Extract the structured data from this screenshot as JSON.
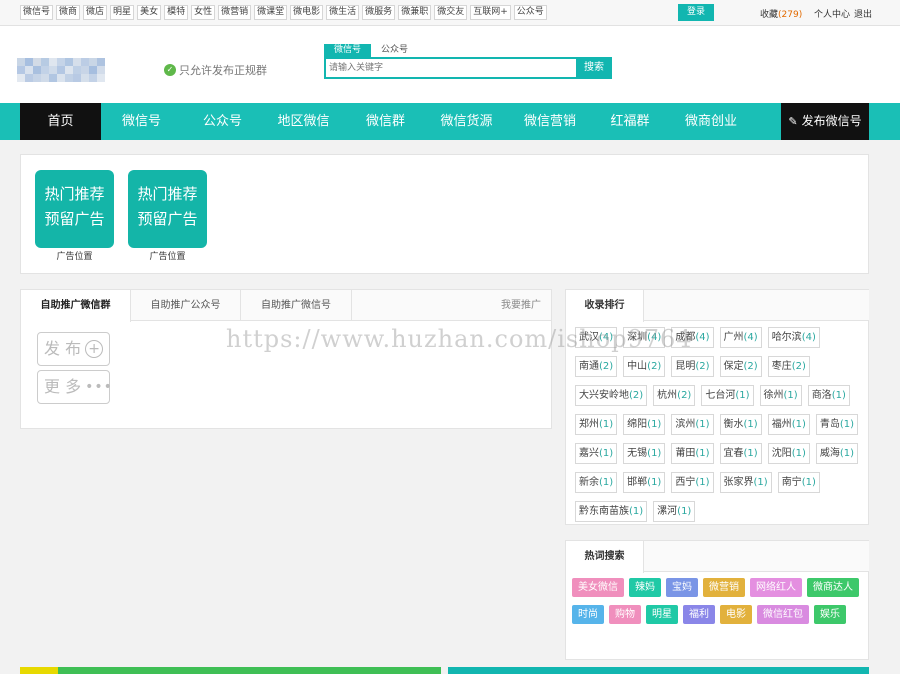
{
  "topbar": {
    "links": [
      "微信号",
      "微商",
      "微店",
      "明星",
      "美女",
      "模特",
      "女性",
      "微营销",
      "微课堂",
      "微电影",
      "微生活",
      "微服务",
      "微兼职",
      "微交友",
      "互联网+",
      "公众号"
    ],
    "login": "登录",
    "fav_label": "收藏",
    "fav_count": "(279)",
    "user_center": "个人中心",
    "logout": "退出"
  },
  "header": {
    "notice": "只允许发布正规群",
    "search_tabs": [
      "微信号",
      "公众号"
    ],
    "search_placeholder": "请输入关键字",
    "search_button": "搜索"
  },
  "nav": {
    "items": [
      "首页",
      "微信号",
      "公众号",
      "地区微信",
      "微信群",
      "微信货源",
      "微信营销",
      "红福群",
      "微商创业"
    ],
    "publish": "发布微信号"
  },
  "ads": [
    {
      "line1": "热门推荐",
      "line2": "预留广告",
      "caption": "广告位置"
    },
    {
      "line1": "热门推荐",
      "line2": "预留广告",
      "caption": "广告位置"
    }
  ],
  "promo": {
    "tabs": [
      "自助推广微信群",
      "自助推广公众号",
      "自助推广微信号"
    ],
    "my_promo": "我要推广",
    "publish": "发 布",
    "more": "更 多"
  },
  "ranking": {
    "title": "收录排行",
    "cities": [
      {
        "name": "武汉",
        "count": "(4)"
      },
      {
        "name": "深圳",
        "count": "(4)"
      },
      {
        "name": "成都",
        "count": "(4)"
      },
      {
        "name": "广州",
        "count": "(4)"
      },
      {
        "name": "哈尔滨",
        "count": "(4)"
      },
      {
        "name": "南通",
        "count": "(2)"
      },
      {
        "name": "中山",
        "count": "(2)"
      },
      {
        "name": "昆明",
        "count": "(2)"
      },
      {
        "name": "保定",
        "count": "(2)"
      },
      {
        "name": "枣庄",
        "count": "(2)"
      },
      {
        "name": "大兴安岭地",
        "count": "(2)"
      },
      {
        "name": "杭州",
        "count": "(2)"
      },
      {
        "name": "七台河",
        "count": "(1)"
      },
      {
        "name": "徐州",
        "count": "(1)"
      },
      {
        "name": "商洛",
        "count": "(1)"
      },
      {
        "name": "郑州",
        "count": "(1)"
      },
      {
        "name": "绵阳",
        "count": "(1)"
      },
      {
        "name": "滨州",
        "count": "(1)"
      },
      {
        "name": "衡水",
        "count": "(1)"
      },
      {
        "name": "福州",
        "count": "(1)"
      },
      {
        "name": "青岛",
        "count": "(1)"
      },
      {
        "name": "嘉兴",
        "count": "(1)"
      },
      {
        "name": "无锡",
        "count": "(1)"
      },
      {
        "name": "莆田",
        "count": "(1)"
      },
      {
        "name": "宜春",
        "count": "(1)"
      },
      {
        "name": "沈阳",
        "count": "(1)"
      },
      {
        "name": "威海",
        "count": "(1)"
      },
      {
        "name": "新余",
        "count": "(1)"
      },
      {
        "name": "邯郸",
        "count": "(1)"
      },
      {
        "name": "西宁",
        "count": "(1)"
      },
      {
        "name": "张家界",
        "count": "(1)"
      },
      {
        "name": "南宁",
        "count": "(1)"
      },
      {
        "name": "黔东南苗族",
        "count": "(1)"
      },
      {
        "name": "漯河",
        "count": "(1)"
      }
    ]
  },
  "hot": {
    "title": "热词搜索",
    "tags": [
      {
        "label": "美女微信",
        "color": "#f08fbd"
      },
      {
        "label": "辣妈",
        "color": "#20c9a6"
      },
      {
        "label": "宝妈",
        "color": "#7a95e6"
      },
      {
        "label": "微营销",
        "color": "#e2b13c"
      },
      {
        "label": "网络红人",
        "color": "#e48fe0"
      },
      {
        "label": "微商达人",
        "color": "#3dc86a"
      },
      {
        "label": "时尚",
        "color": "#56b4ea"
      },
      {
        "label": "购物",
        "color": "#f08fbd"
      },
      {
        "label": "明星",
        "color": "#20c9a6"
      },
      {
        "label": "福利",
        "color": "#8a86e8"
      },
      {
        "label": "电影",
        "color": "#e2b13c"
      },
      {
        "label": "微信红包",
        "color": "#d98be0"
      },
      {
        "label": "娱乐",
        "color": "#3dc86a"
      }
    ]
  },
  "watermark": "https://www.huzhan.com/ishop9764"
}
